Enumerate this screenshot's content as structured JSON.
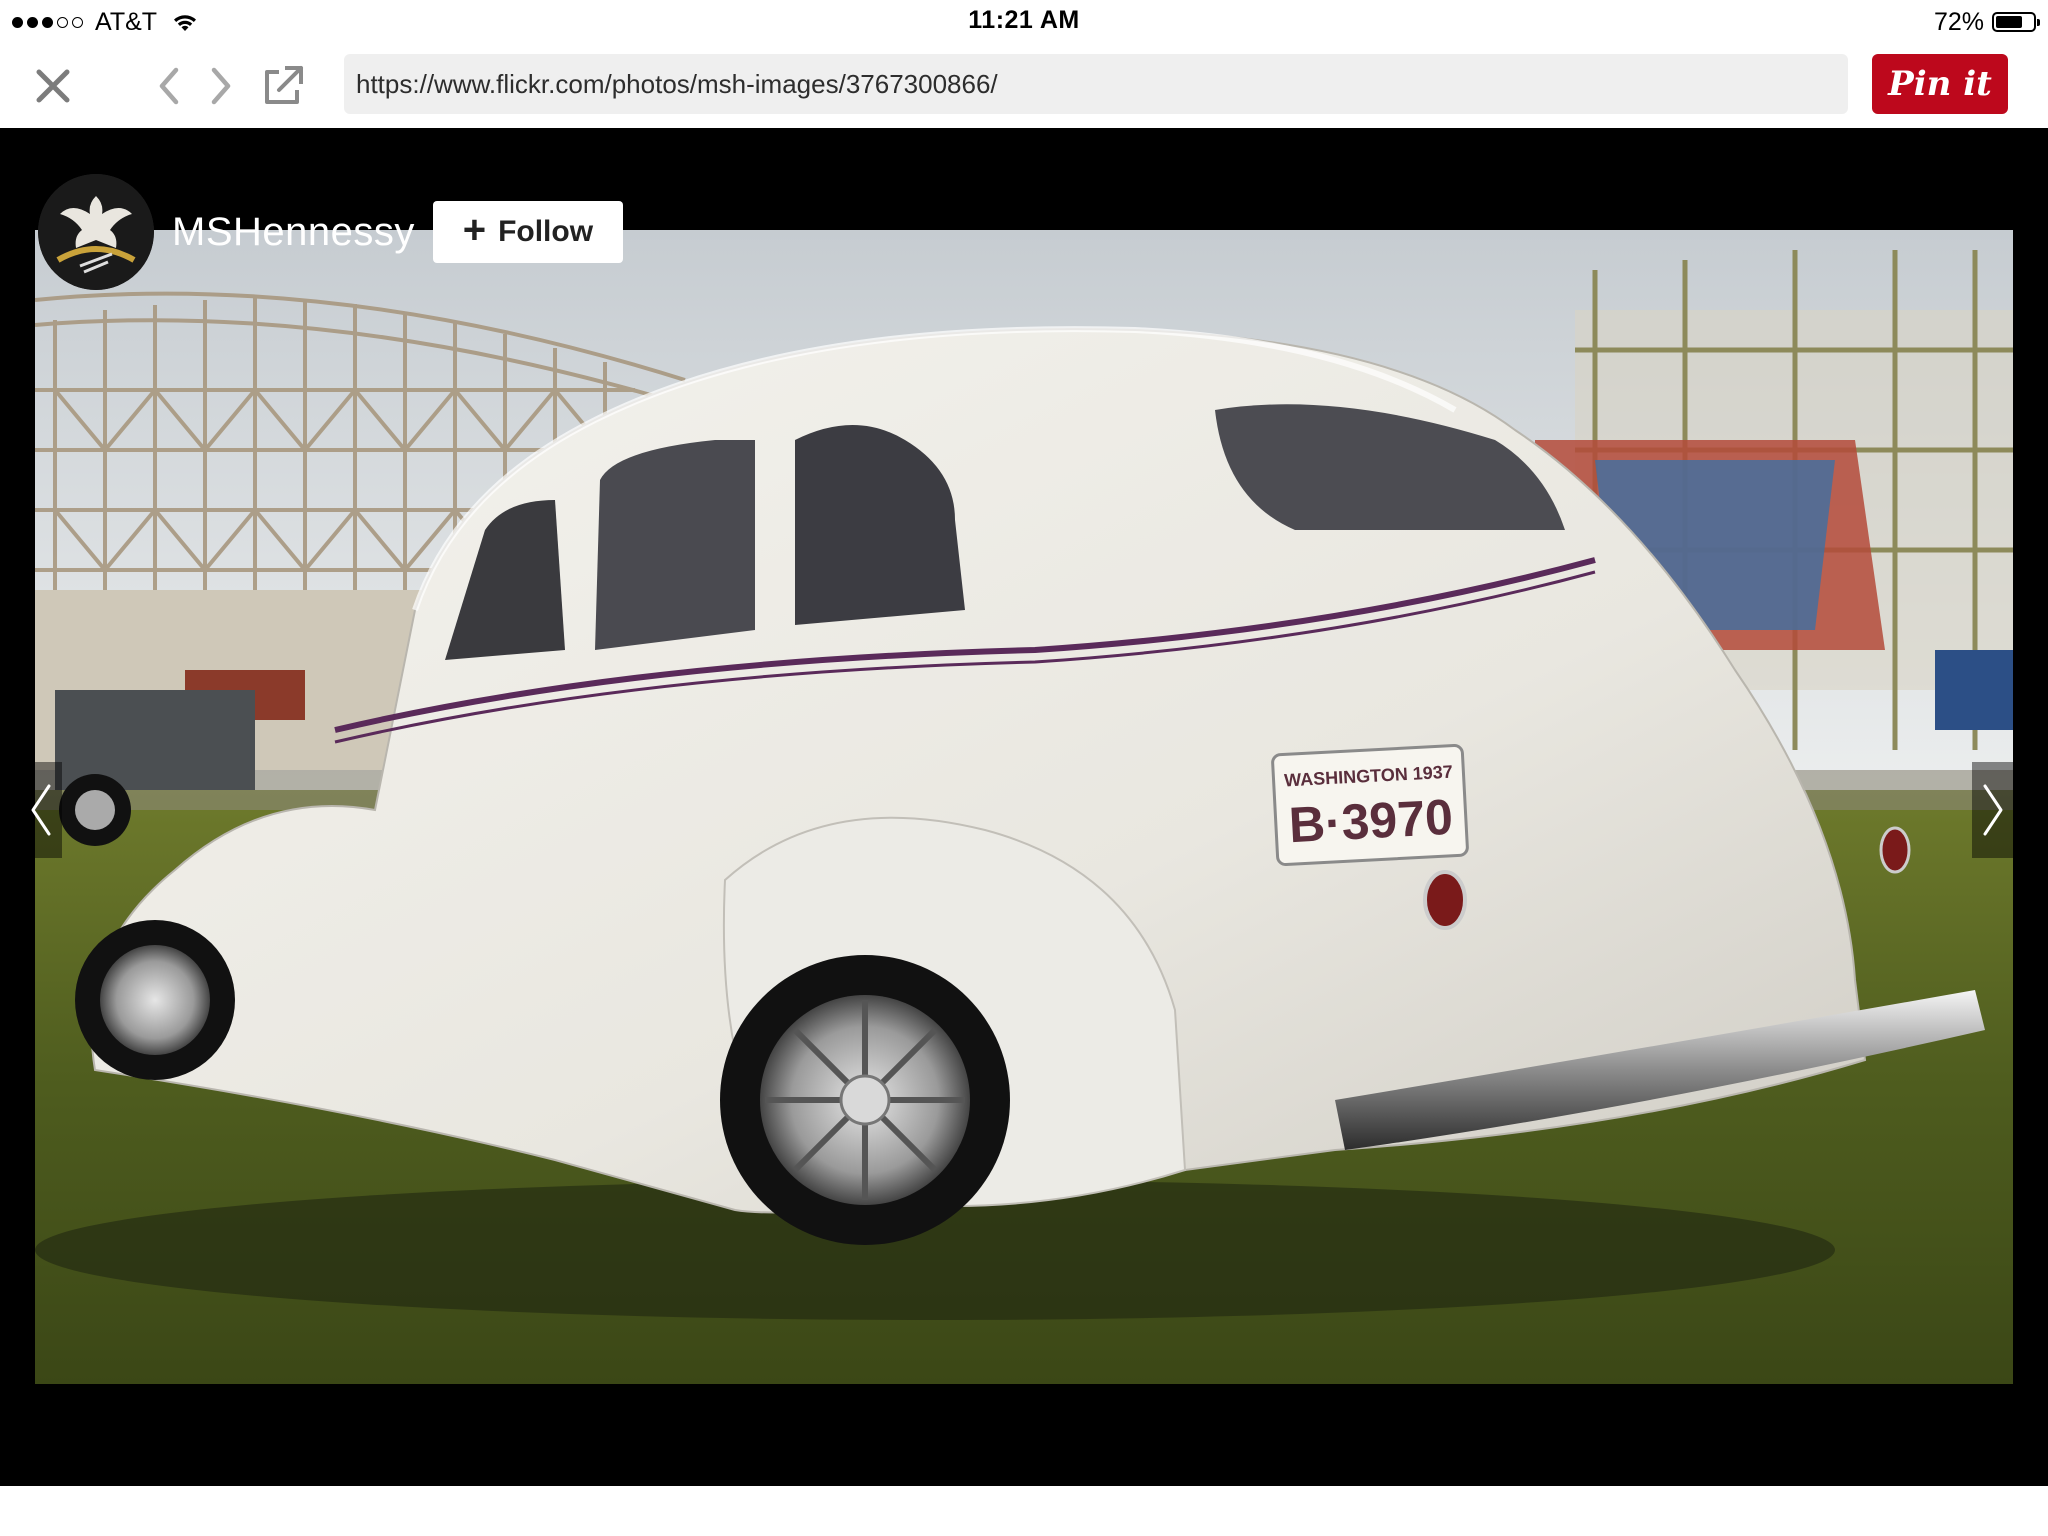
{
  "status_bar": {
    "carrier": "AT&T",
    "time": "11:21 AM",
    "battery_percent": "72%",
    "battery_level": 0.72,
    "signal_bars_filled": 3,
    "signal_bars_total": 5
  },
  "toolbar": {
    "url": "https://www.flickr.com/photos/msh-images/3767300866/",
    "pin_label": "Pin it",
    "pin_color": "#bd081c"
  },
  "viewer": {
    "owner_name": "MSHennessy",
    "follow_label": "Follow",
    "photo": {
      "plate_top": "WASHINGTON 1937",
      "plate_number": "B·3970"
    }
  },
  "icons": {
    "close": "close-icon",
    "back": "chevron-left-icon",
    "forward": "chevron-right-icon",
    "share": "open-external-icon",
    "wifi": "wifi-icon",
    "battery": "battery-icon",
    "plus": "plus-icon"
  }
}
